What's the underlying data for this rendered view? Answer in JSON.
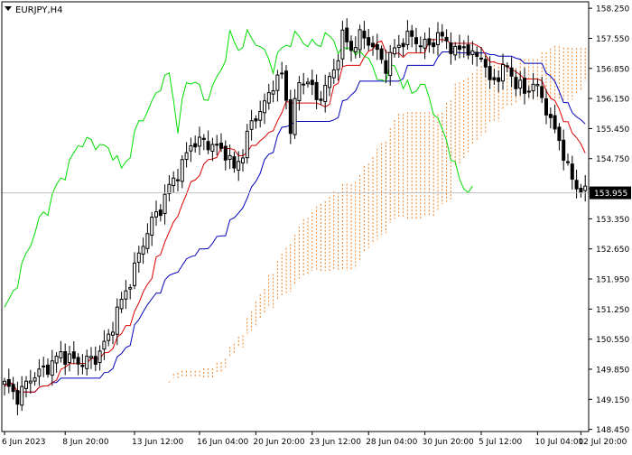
{
  "chart_data": {
    "type": "candlestick",
    "title": "EURJPY,H4",
    "ylim": [
      148.4,
      158.4
    ],
    "yticks": [
      {
        "value": 158.25,
        "label": "158.250"
      },
      {
        "value": 157.55,
        "label": "157.550"
      },
      {
        "value": 156.85,
        "label": "156.850"
      },
      {
        "value": 156.15,
        "label": "156.150"
      },
      {
        "value": 155.45,
        "label": "155.450"
      },
      {
        "value": 154.75,
        "label": "154.750"
      },
      {
        "value": 154.05,
        "label": "154.050"
      },
      {
        "value": 153.35,
        "label": "153.350"
      },
      {
        "value": 152.65,
        "label": "152.650"
      },
      {
        "value": 151.95,
        "label": "151.950"
      },
      {
        "value": 151.25,
        "label": "151.250"
      },
      {
        "value": 150.55,
        "label": "150.550"
      },
      {
        "value": 149.85,
        "label": "149.850"
      },
      {
        "value": 149.15,
        "label": "149.150"
      },
      {
        "value": 148.45,
        "label": "148.450"
      }
    ],
    "xticks": [
      {
        "index": 0,
        "label": "6 Jun 2023"
      },
      {
        "index": 14,
        "label": "8 Jun 20:00"
      },
      {
        "index": 30,
        "label": "13 Jun 12:00"
      },
      {
        "index": 45,
        "label": "16 Jun 04:00"
      },
      {
        "index": 58,
        "label": "20 Jun 20:00"
      },
      {
        "index": 71,
        "label": "23 Jun 12:00"
      },
      {
        "index": 84,
        "label": "28 Jun 04:00"
      },
      {
        "index": 97,
        "label": "30 Jun 20:00"
      },
      {
        "index": 110,
        "label": "5 Jul 12:00"
      },
      {
        "index": 123,
        "label": "10 Jul 04:00"
      },
      {
        "index": 133,
        "label": "12 Jul 20:00"
      }
    ],
    "current_price": {
      "value": 153.955,
      "label": "153.955"
    },
    "bar_spacing": 4.8,
    "cloud_offset": 26,
    "candles": [],
    "indicators": {
      "tenkan_color": "#dd0000",
      "kijun_color": "#0000bb",
      "chikou_color": "#00dd00",
      "cloud_up_color": "#f08020",
      "cloud_down_color": "#d8a0d8"
    },
    "colors": {
      "up": "#000000",
      "down": "#000000",
      "grid_line": "#c0c0c0"
    }
  }
}
